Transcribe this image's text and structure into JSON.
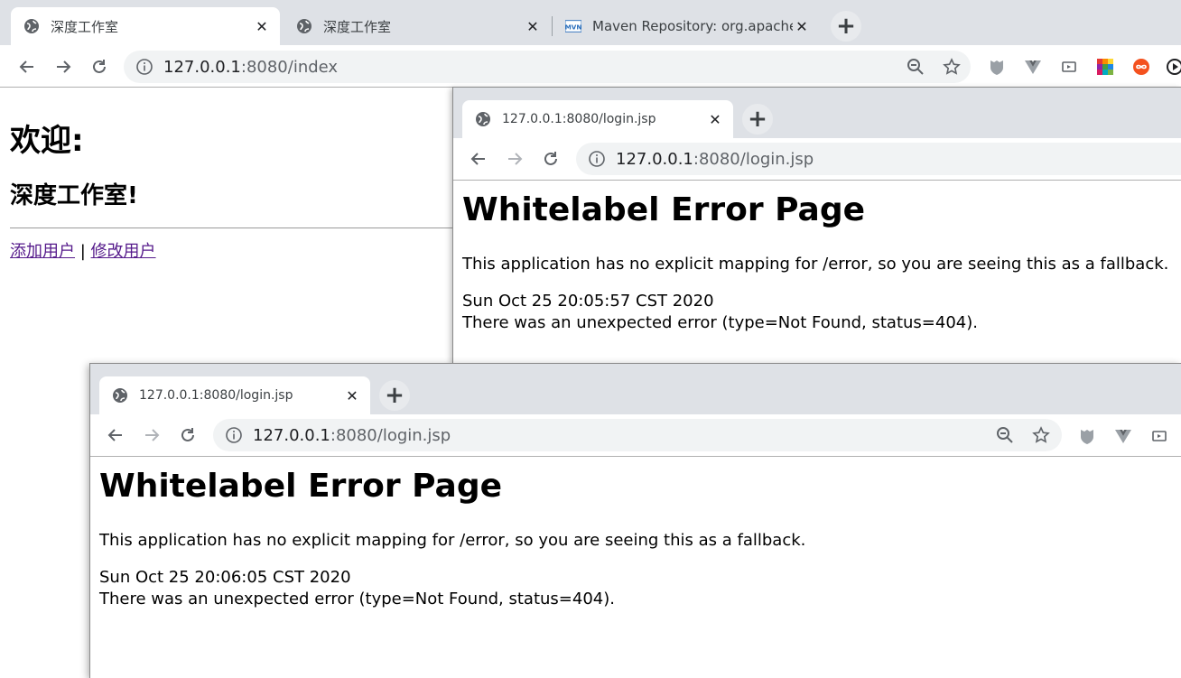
{
  "main_window": {
    "tabs": [
      {
        "title": "深度工作室",
        "active": true,
        "favicon": "globe-icon"
      },
      {
        "title": "深度工作室",
        "active": false,
        "favicon": "globe-icon"
      },
      {
        "title": "Maven Repository: org.apache",
        "active": false,
        "favicon": "mvn-icon"
      }
    ],
    "url_host": "127.0.0.1",
    "url_rest": ":8080/index",
    "extensions": [
      "shield-extension-icon",
      "vue-extension-icon",
      "cast-extension-icon",
      "colorful-grid-extension-icon",
      "infinity-extension-icon",
      "media-extension-icon"
    ],
    "page": {
      "heading": "欢迎:",
      "subheading": "深度工作室!",
      "link_add": "添加用户",
      "separator": "|",
      "link_edit": "修改用户"
    }
  },
  "second_window": {
    "tab_title": "127.0.0.1:8080/login.jsp",
    "url_host": "127.0.0.1",
    "url_rest": ":8080/login.jsp",
    "page": {
      "title": "Whitelabel Error Page",
      "message": "This application has no explicit mapping for /error, so you are seeing this as a fallback.",
      "timestamp": "Sun Oct 25 20:05:57 CST 2020",
      "error": "There was an unexpected error (type=Not Found, status=404)."
    }
  },
  "third_window": {
    "tab_title": "127.0.0.1:8080/login.jsp",
    "url_host": "127.0.0.1",
    "url_rest": ":8080/login.jsp",
    "page": {
      "title": "Whitelabel Error Page",
      "message": "This application has no explicit mapping for /error, so you are seeing this as a fallback.",
      "timestamp": "Sun Oct 25 20:06:05 CST 2020",
      "error": "There was an unexpected error (type=Not Found, status=404)."
    }
  },
  "colors": {
    "tabstrip": "#dee1e6",
    "omnibox": "#f1f3f4",
    "visited_link": "#551a8b"
  }
}
